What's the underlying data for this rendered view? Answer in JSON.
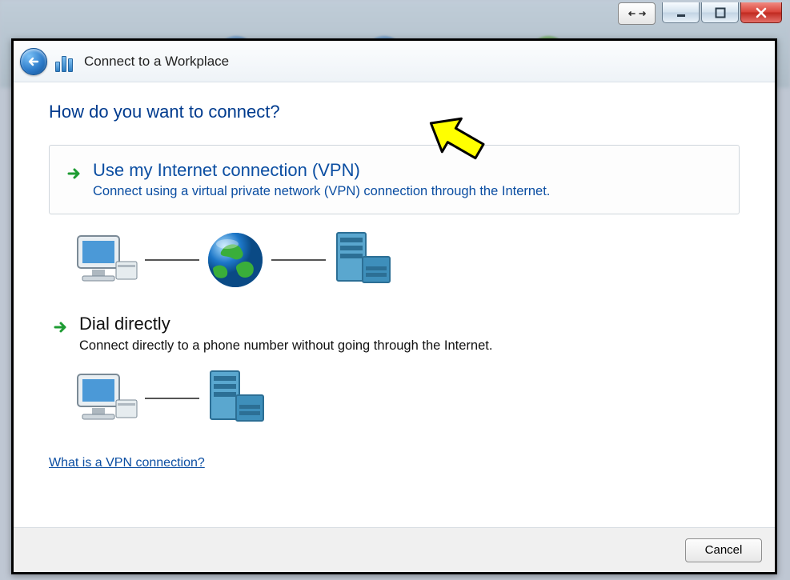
{
  "window": {
    "title": "Connect to a Workplace"
  },
  "main": {
    "question": "How do you want to connect?",
    "option_vpn": {
      "title": "Use my Internet connection (VPN)",
      "description": "Connect using a virtual private network (VPN) connection through the Internet."
    },
    "option_dial": {
      "title": "Dial directly",
      "description": "Connect directly to a phone number without going through the Internet."
    },
    "help_link": "What is a VPN connection?"
  },
  "footer": {
    "cancel": "Cancel"
  },
  "icons": {
    "back": "back-arrow",
    "computer": "computer-icon",
    "globe": "globe-icon",
    "server": "server-icon",
    "go": "go-arrow",
    "minimize": "minimize-icon",
    "maximize": "maximize-icon",
    "close": "close-icon",
    "prevnext": "double-arrow-icon"
  }
}
